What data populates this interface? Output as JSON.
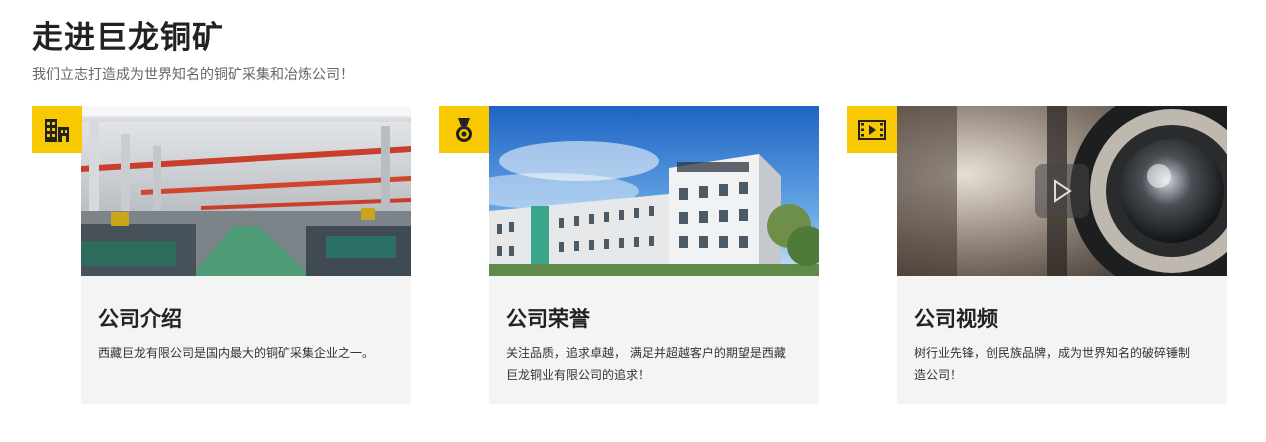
{
  "section": {
    "title": "走进巨龙铜矿",
    "subtitle": "我们立志打造成为世界知名的铜矿采集和冶炼公司！"
  },
  "cards": [
    {
      "title": "公司介绍",
      "description": "西藏巨龙有限公司是国内最大的铜矿采集企业之一。",
      "icon": "building-icon"
    },
    {
      "title": "公司荣誉",
      "description": "关注品质，追求卓越， 满足并超越客户的期望是西藏巨龙铜业有限公司的追求！",
      "icon": "medal-icon"
    },
    {
      "title": "公司视频",
      "description": "树行业先锋，创民族品牌，成为世界知名的破碎锤制造公司！",
      "icon": "film-icon"
    }
  ],
  "colors": {
    "accent": "#f8c800",
    "card_bg": "#f4f4f4",
    "title": "#222222",
    "subtitle": "#666666"
  }
}
